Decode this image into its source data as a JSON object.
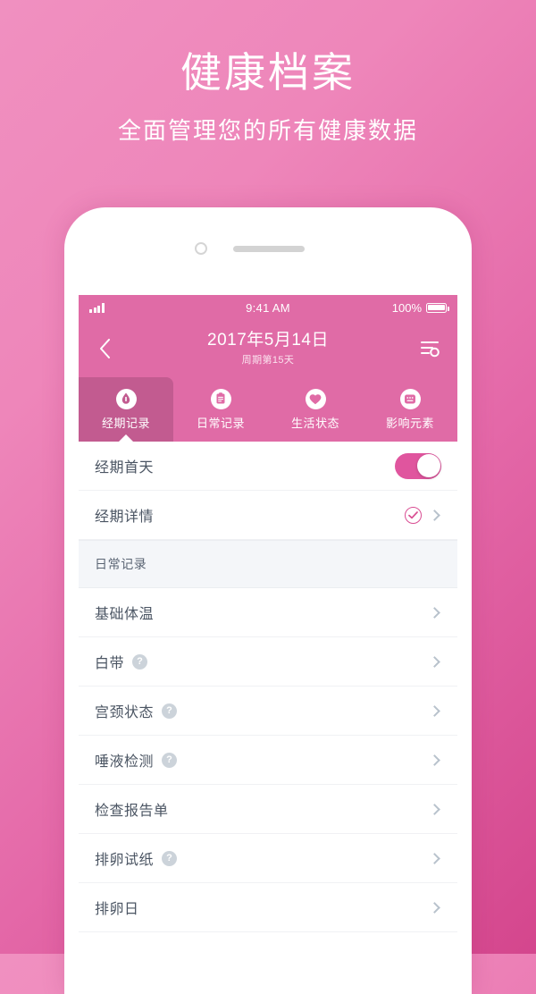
{
  "promo": {
    "title": "健康档案",
    "subtitle": "全面管理您的所有健康数据"
  },
  "statusbar": {
    "time": "9:41 AM",
    "battery_text": "100%",
    "signal_icon": "signal-bars-icon",
    "battery_icon": "battery-full-icon"
  },
  "navbar": {
    "back_icon": "chevron-left-icon",
    "title": "2017年5月14日",
    "subtitle": "周期第15天",
    "settings_icon": "list-settings-icon"
  },
  "tabs": [
    {
      "label": "经期记录",
      "icon": "period-drop-icon",
      "active": true
    },
    {
      "label": "日常记录",
      "icon": "clipboard-icon",
      "active": false
    },
    {
      "label": "生活状态",
      "icon": "heart-icon",
      "active": false
    },
    {
      "label": "影响元素",
      "icon": "frame-icon",
      "active": false
    }
  ],
  "list": {
    "period_rows": [
      {
        "label": "经期首天",
        "control": "toggle",
        "toggle_on": true
      },
      {
        "label": "经期详情",
        "control": "check-chevron",
        "checked": true
      }
    ],
    "section_title": "日常记录",
    "daily_rows": [
      {
        "label": "基础体温",
        "help": false
      },
      {
        "label": "白带",
        "help": true
      },
      {
        "label": "宫颈状态",
        "help": true
      },
      {
        "label": "唾液检测",
        "help": true
      },
      {
        "label": "检查报告单",
        "help": false
      },
      {
        "label": "排卵试纸",
        "help": true
      },
      {
        "label": "排卵日",
        "help": false
      }
    ],
    "help_glyph": "?"
  },
  "colors": {
    "brand_pink": "#e06ba6",
    "active_tab": "#c25b90",
    "toggle_on": "#e0559e",
    "check_pink": "#d94d92",
    "bg_gradient_from": "#f090c0",
    "bg_gradient_to": "#d4468d",
    "row_text": "#4b5563",
    "section_bg": "#f4f6f9"
  }
}
